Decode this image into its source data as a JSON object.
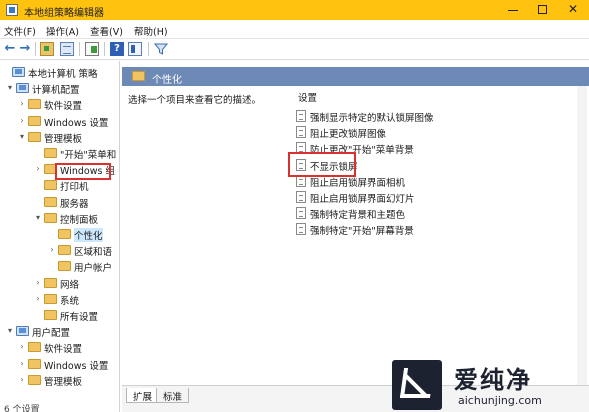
{
  "window": {
    "title": "本地组策略编辑器",
    "controls": {
      "minimize": "—",
      "maximize": "☐",
      "close": "✕"
    }
  },
  "menubar": {
    "items": [
      "文件(F)",
      "操作(A)",
      "查看(V)",
      "帮助(H)"
    ]
  },
  "toolbar": {
    "icons": [
      "arrow-left-icon",
      "arrow-right-icon",
      "folder-up-icon",
      "show-hide-tree-icon",
      "export-list-icon",
      "help-icon",
      "properties-icon",
      "filter-icon"
    ]
  },
  "tree": {
    "nodes": [
      {
        "label": "本地计算机 策略",
        "level": 0,
        "expander": "",
        "icon": "computer-policy-icon"
      },
      {
        "label": "计算机配置",
        "level": 1,
        "expander": "v",
        "icon": "computer-config-icon"
      },
      {
        "label": "软件设置",
        "level": 2,
        "expander": ">",
        "icon": "folder-icon"
      },
      {
        "label": "Windows 设置",
        "level": 2,
        "expander": ">",
        "icon": "folder-icon"
      },
      {
        "label": "管理模板",
        "level": 2,
        "expander": "v",
        "icon": "folder-icon"
      },
      {
        "label": "\"开始\"菜单和",
        "level": 3,
        "expander": "",
        "icon": "folder-icon"
      },
      {
        "label": "Windows 组",
        "level": 3,
        "expander": ">",
        "icon": "folder-icon"
      },
      {
        "label": "打印机",
        "level": 3,
        "expander": "",
        "icon": "folder-icon"
      },
      {
        "label": "服务器",
        "level": 3,
        "expander": "",
        "icon": "folder-icon"
      },
      {
        "label": "控制面板",
        "level": 3,
        "expander": "v",
        "icon": "folder-icon"
      },
      {
        "label": "个性化",
        "level": 4,
        "expander": "",
        "icon": "folder-open-icon",
        "selected": true
      },
      {
        "label": "区域和语",
        "level": 4,
        "expander": ">",
        "icon": "folder-icon"
      },
      {
        "label": "用户帐户",
        "level": 4,
        "expander": "",
        "icon": "folder-icon"
      },
      {
        "label": "网络",
        "level": 3,
        "expander": ">",
        "icon": "folder-icon"
      },
      {
        "label": "系统",
        "level": 3,
        "expander": ">",
        "icon": "folder-icon"
      },
      {
        "label": "所有设置",
        "level": 3,
        "expander": "",
        "icon": "folder-icon"
      },
      {
        "label": "用户配置",
        "level": 1,
        "expander": "v",
        "icon": "user-config-icon"
      },
      {
        "label": "软件设置",
        "level": 2,
        "expander": ">",
        "icon": "folder-icon"
      },
      {
        "label": "Windows 设置",
        "level": 2,
        "expander": ">",
        "icon": "folder-icon"
      },
      {
        "label": "管理模板",
        "level": 2,
        "expander": ">",
        "icon": "folder-icon"
      }
    ]
  },
  "status": {
    "text": "6 个设置"
  },
  "content": {
    "header": "个性化",
    "description": "选择一个项目来查看它的描述。",
    "list_header": "设置",
    "settings": [
      "强制显示特定的默认锁屏图像",
      "阻止更改锁屏图像",
      "防止更改\"开始\"菜单背景",
      "不显示锁屏",
      "阻止启用锁屏界面相机",
      "阻止启用锁屏界面幻灯片",
      "强制特定背景和主题色",
      "强制特定\"开始\"屏幕背景"
    ],
    "highlighted_setting": "不显示锁屏"
  },
  "tabs": {
    "extended": "扩展",
    "standard": "标准"
  },
  "watermark": {
    "cn": "爱纯净",
    "en": "aichunjing.com"
  },
  "colors": {
    "titlebar": "#ffc20e",
    "header": "#6d89b6",
    "highlight": "#d93030",
    "watermark": "#1d2230"
  }
}
